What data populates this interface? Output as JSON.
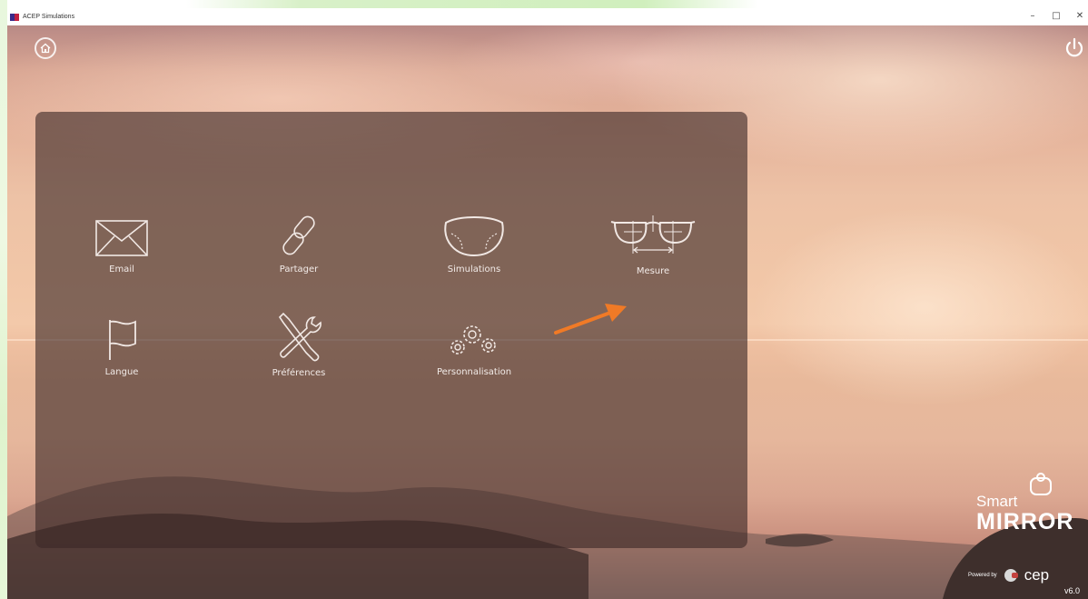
{
  "window": {
    "title": "ACEP Simulations",
    "minimize": "–",
    "maximize": "□",
    "close": "✕"
  },
  "menu": {
    "items": [
      {
        "label": "Email",
        "icon": "envelope-icon"
      },
      {
        "label": "Partager",
        "icon": "link-icon"
      },
      {
        "label": "Simulations",
        "icon": "lens-icon"
      },
      {
        "label": "Mesure",
        "icon": "glasses-measure-icon"
      },
      {
        "label": "Langue",
        "icon": "flag-icon"
      },
      {
        "label": "Préférences",
        "icon": "tools-icon"
      },
      {
        "label": "Personnalisation",
        "icon": "gears-icon"
      }
    ]
  },
  "brand": {
    "smart": "Smart",
    "mirror": "MIRROR",
    "powered_by": "Powered by",
    "acep": "cep",
    "version": "v6.0"
  },
  "colors": {
    "arrow": "#f07a26",
    "panel": "#3c2826"
  }
}
